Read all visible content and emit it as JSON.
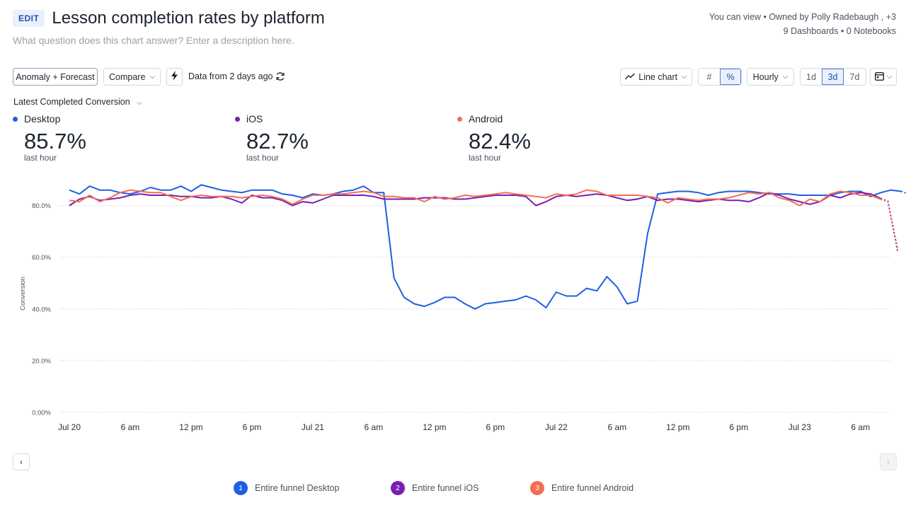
{
  "header": {
    "edit_label": "EDIT",
    "title": "Lesson completion rates by platform",
    "description_placeholder": "What question does this chart answer? Enter a description here.",
    "access_line": "You can view • Owned by Polly Radebaugh , +3",
    "usage_line": "9 Dashboards • 0 Notebooks"
  },
  "toolbar": {
    "anomaly_label": "Anomaly + Forecast",
    "compare_label": "Compare",
    "data_freshness": "Data from 2 days ago",
    "chart_type_label": "Line chart",
    "hash_label": "#",
    "percent_label": "%",
    "interval_label": "Hourly",
    "ranges": [
      "1d",
      "3d",
      "7d"
    ],
    "active_range": "3d"
  },
  "metric_selector": "Latest Completed Conversion",
  "kpis": [
    {
      "name": "Desktop",
      "value": "85.7%",
      "sub": "last hour",
      "color": "#1f5fe0"
    },
    {
      "name": "iOS",
      "value": "82.7%",
      "sub": "last hour",
      "color": "#7a1fb0"
    },
    {
      "name": "Android",
      "value": "82.4%",
      "sub": "last hour",
      "color": "#f56e54"
    }
  ],
  "chart_data": {
    "type": "line",
    "ylabel": "Conversion",
    "ylim": [
      0,
      100
    ],
    "y_ticks": [
      "0.00%",
      "20.0%",
      "40.0%",
      "60.0%",
      "80.0%"
    ],
    "y_tick_values": [
      0,
      20,
      40,
      60,
      80
    ],
    "x_tick_labels": [
      "Jul 20",
      "6 am",
      "12 pm",
      "6 pm",
      "Jul 21",
      "6 am",
      "12 pm",
      "6 pm",
      "Jul 22",
      "6 am",
      "12 pm",
      "6 pm",
      "Jul 23",
      "6 am"
    ],
    "x_tick_hours": [
      0,
      6,
      12,
      18,
      24,
      30,
      36,
      42,
      48,
      54,
      60,
      66,
      72,
      78
    ],
    "x_range_hours": [
      0,
      81
    ],
    "grid": true,
    "series": [
      {
        "name": "Entire funnel Desktop",
        "color": "#1f5fe0",
        "values": [
          86,
          84.5,
          87.5,
          86,
          86,
          85,
          84.5,
          85.5,
          87,
          86,
          86,
          87.5,
          85.5,
          88,
          87,
          86,
          85.5,
          85,
          86,
          86,
          86,
          84.5,
          84,
          83,
          84.5,
          84,
          84.5,
          85.5,
          86,
          87.5,
          85,
          85,
          52,
          44.5,
          42,
          41,
          42.5,
          44.5,
          44.5,
          42,
          40,
          42,
          42.5,
          43,
          43.5,
          45,
          43.5,
          40.5,
          46.5,
          45,
          45,
          48,
          47,
          52.5,
          48.5,
          42,
          43,
          69,
          84.5,
          85,
          85.5,
          85.5,
          85,
          84,
          85,
          85.5,
          85.5,
          85.5,
          85,
          84.5,
          84.5,
          84.5,
          84,
          84,
          84,
          84,
          85,
          85.5,
          85.5,
          83.5,
          85,
          86,
          85.5
        ]
      },
      {
        "name": "Entire funnel iOS",
        "color": "#7a1fb0",
        "values": [
          80,
          82.5,
          83.5,
          82,
          82.5,
          83,
          84,
          84.5,
          84,
          84,
          84,
          83.5,
          83.5,
          83,
          83,
          83.5,
          82.5,
          81,
          84,
          83,
          83,
          82,
          80,
          81.5,
          81,
          82.5,
          84,
          84,
          84,
          84,
          83.5,
          82.5,
          82.5,
          82.5,
          82.5,
          83,
          83,
          83,
          82.5,
          82.5,
          83,
          83.5,
          84,
          84,
          84,
          83.5,
          80,
          81.5,
          83.5,
          84,
          83.5,
          84,
          84.5,
          84,
          83,
          82,
          82.5,
          83.5,
          82,
          82.5,
          82.5,
          82,
          81.5,
          82,
          82.5,
          82,
          82,
          81.5,
          83,
          85,
          84,
          82.5,
          81.5,
          80.5,
          81.5,
          84,
          83,
          84.5,
          85,
          84.5,
          82.7
        ]
      },
      {
        "name": "Entire funnel Android",
        "color": "#f56e54",
        "values": [
          82,
          81.5,
          84,
          81.5,
          83,
          85,
          86,
          85.5,
          85,
          85,
          83.5,
          82,
          83.5,
          84,
          83.5,
          83.5,
          83.5,
          83,
          83.5,
          84,
          83.5,
          82.5,
          80.5,
          82.5,
          84,
          84,
          84.5,
          84.5,
          85,
          85.5,
          85,
          83.5,
          83.5,
          83,
          83,
          81.5,
          83.5,
          82.5,
          83,
          84,
          83.5,
          84,
          84.5,
          85,
          84.5,
          84,
          83.5,
          83,
          84.5,
          84,
          84.5,
          86,
          85.5,
          84,
          84,
          84,
          84,
          83.5,
          83,
          81,
          83,
          82.5,
          82,
          82.5,
          82.5,
          83,
          84,
          85,
          84.5,
          85,
          83,
          82,
          80,
          82.5,
          81.5,
          84.5,
          85.5,
          85,
          84,
          84,
          82.4
        ]
      }
    ]
  },
  "nav": {
    "prev": "‹",
    "next": "›"
  },
  "legend": [
    {
      "num": "1",
      "label": "Entire funnel Desktop",
      "color": "#1f5fe0"
    },
    {
      "num": "2",
      "label": "Entire funnel iOS",
      "color": "#7a1fb0"
    },
    {
      "num": "3",
      "label": "Entire funnel Android",
      "color": "#f56e54"
    }
  ]
}
